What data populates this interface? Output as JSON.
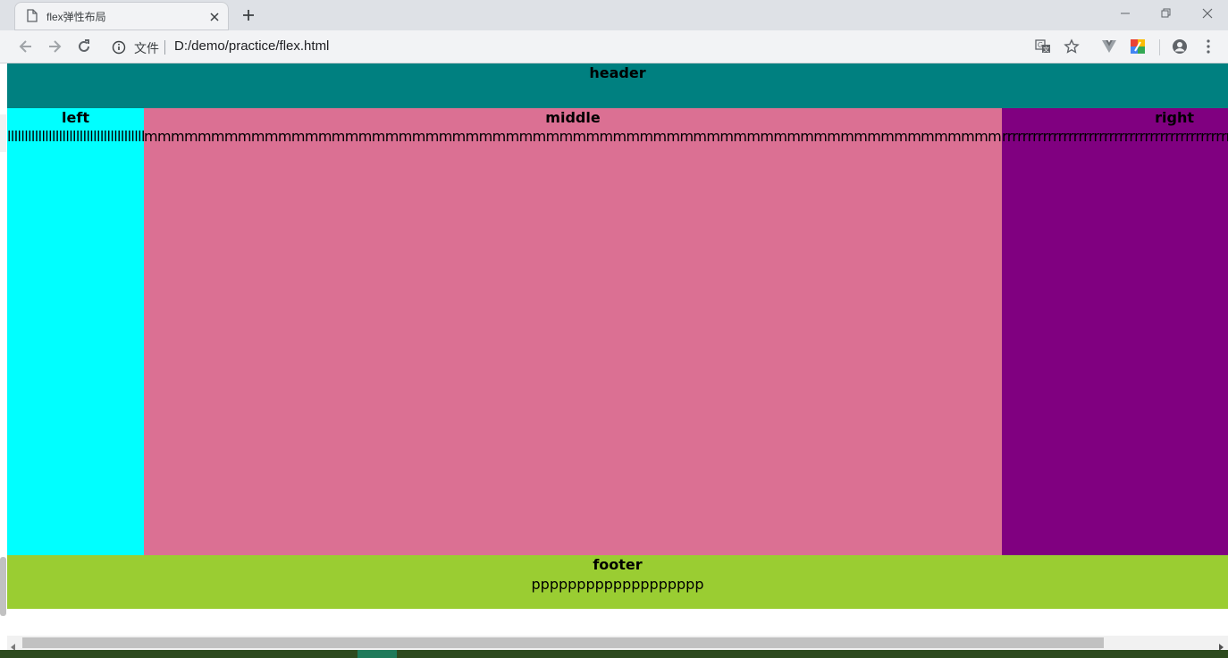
{
  "browser": {
    "tab_title": "flex弹性布局",
    "security_label": "文件",
    "url": "D:/demo/practice/flex.html"
  },
  "icons": {
    "tab": "document-icon",
    "tab_close": "close-icon",
    "new_tab": "plus-icon",
    "back": "arrow-left-icon",
    "forward": "arrow-right-icon",
    "reload": "reload-icon",
    "info": "info-icon",
    "translate": "translate-icon",
    "bookmark": "star-icon",
    "extension_1": "vue-devtools-icon",
    "extension_2": "extension-color-icon",
    "profile": "account-icon",
    "menu": "kebab-menu-icon"
  },
  "page": {
    "header": {
      "title": "header",
      "color": "#008080"
    },
    "left": {
      "title": "left",
      "text": "llllllllllllllllllllllllllllllllllllllllllll",
      "color": "#00ffff"
    },
    "middle": {
      "title": "middle",
      "text": "mmmmmmmmmmmmmmmmmmmmmmmmmmmmmmmmmmmmmmmmmmmmmmmmmmmmmmmmmmmmmmmmmmmmmmmmmmmmmmmmmm",
      "color": "#db7093"
    },
    "right": {
      "title": "right",
      "text": "rrrrrrrrrrrrrrrrrrrrrrrrrrrrrrrrrrrrrrrrrrrrrrrrrrrrrrrr",
      "color": "#800080"
    },
    "footer": {
      "title": "footer",
      "text": "ppppppppppppppppppp",
      "color": "#9acd32"
    }
  }
}
